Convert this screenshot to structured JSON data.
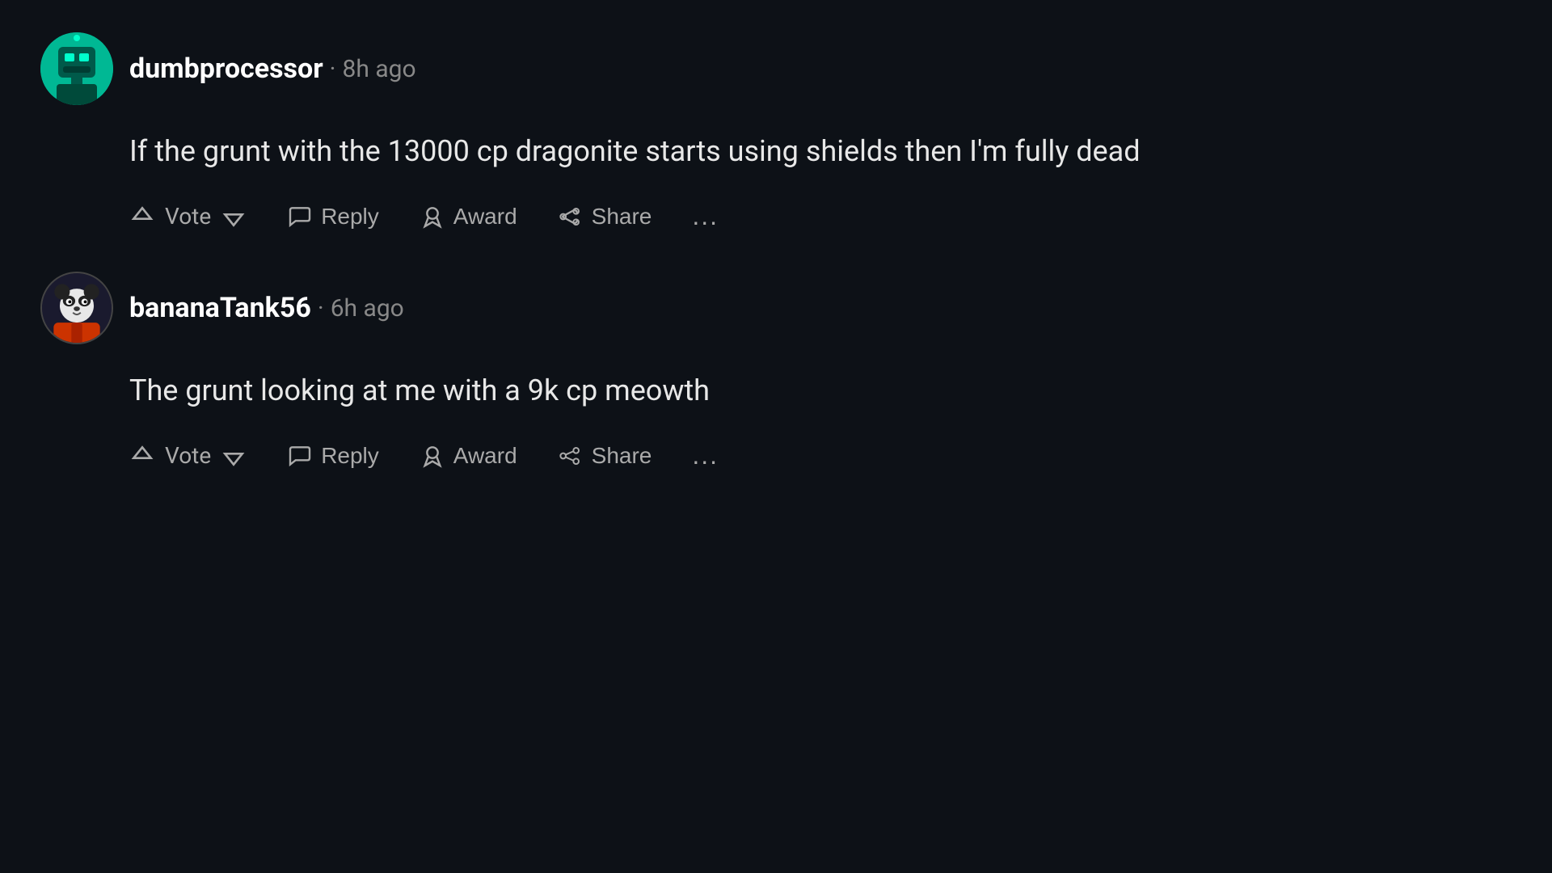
{
  "comments": [
    {
      "id": "comment-1",
      "username": "dumbprocessor",
      "timestamp": "8h ago",
      "text": "If the grunt with the 13000 cp dragonite starts using shields then I'm fully dead",
      "avatar_color": "#00b894",
      "avatar_type": "robot-green"
    },
    {
      "id": "comment-2",
      "username": "bananaTank56",
      "timestamp": "6h ago",
      "text": "The grunt looking at me with a 9k cp meowth",
      "avatar_color": "#1a1a2e",
      "avatar_type": "panda"
    }
  ],
  "actions": {
    "vote": "Vote",
    "reply": "Reply",
    "award": "Award",
    "share": "Share",
    "more": "..."
  }
}
